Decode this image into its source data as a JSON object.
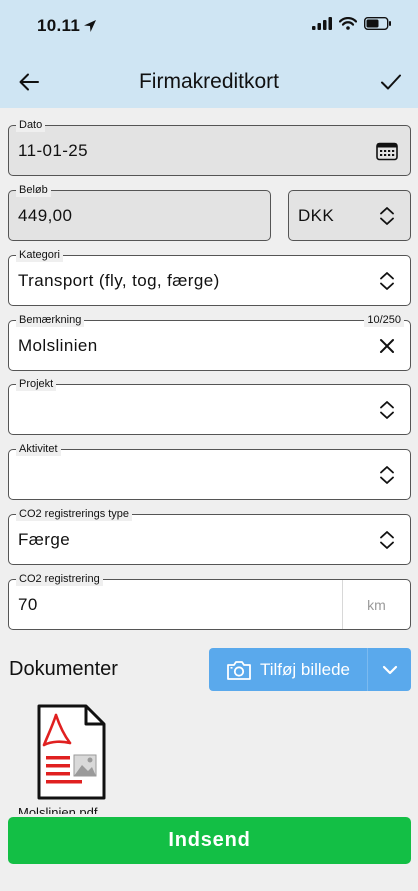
{
  "status_bar": {
    "time": "10.11"
  },
  "nav": {
    "title": "Firmakreditkort"
  },
  "form": {
    "date": {
      "label": "Dato",
      "value": "11-01-25"
    },
    "amount": {
      "label": "Beløb",
      "value": "449,00"
    },
    "currency": {
      "value": "DKK"
    },
    "category": {
      "label": "Kategori",
      "value": "Transport (fly, tog, færge)"
    },
    "note": {
      "label": "Bemærkning",
      "value": "Molslinien",
      "counter": "10/250"
    },
    "project": {
      "label": "Projekt",
      "value": ""
    },
    "activity": {
      "label": "Aktivitet",
      "value": ""
    },
    "co2_type": {
      "label": "CO2 registrerings type",
      "value": "Færge"
    },
    "co2": {
      "label": "CO2 registrering",
      "value": "70",
      "unit": "km"
    }
  },
  "documents": {
    "title": "Dokumenter",
    "add_label": "Tilføj billede",
    "files": [
      {
        "name": "Molslinien.pdf",
        "icon": "pdf-file-icon"
      }
    ]
  },
  "submit_label": "Indsend",
  "colors": {
    "header": "#cfe5f3",
    "add_button": "#5aa9ec",
    "submit": "#13bf45",
    "pdf": "#e02020"
  }
}
